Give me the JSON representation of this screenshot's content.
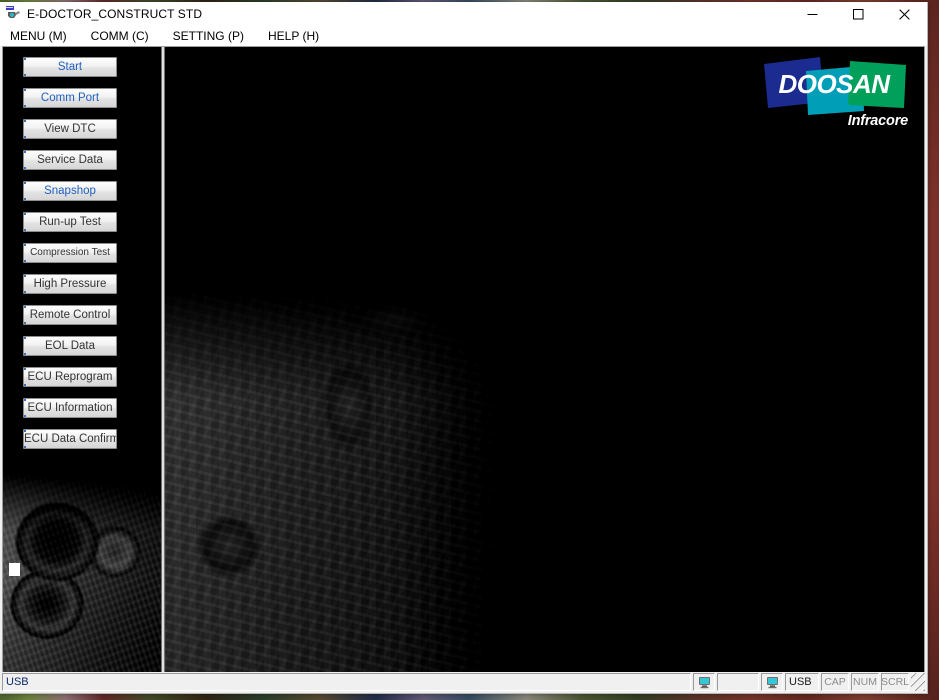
{
  "window": {
    "title": "E-DOCTOR_CONSTRUCT STD",
    "app_icon": "diagnostic-device-icon",
    "controls": {
      "minimize": "—",
      "maximize": "□",
      "close": "✕"
    }
  },
  "menu": {
    "items": [
      {
        "label": "MENU (M)",
        "name": "menu-menu"
      },
      {
        "label": "COMM (C)",
        "name": "menu-comm"
      },
      {
        "label": "SETTING (P)",
        "name": "menu-setting"
      },
      {
        "label": "HELP (H)",
        "name": "menu-help"
      }
    ]
  },
  "sidebar": {
    "buttons": [
      {
        "label": "Start",
        "accent": true
      },
      {
        "label": "Comm Port",
        "accent": true
      },
      {
        "label": "View DTC",
        "accent": false
      },
      {
        "label": "Service Data",
        "accent": false
      },
      {
        "label": "Snapshop",
        "accent": true
      },
      {
        "label": "Run-up Test",
        "accent": false
      },
      {
        "label": "Compression Test",
        "accent": false
      },
      {
        "label": "High Pressure",
        "accent": false
      },
      {
        "label": "Remote Control",
        "accent": false
      },
      {
        "label": "EOL Data",
        "accent": false
      },
      {
        "label": "ECU Reprogram",
        "accent": false
      },
      {
        "label": "ECU Information",
        "accent": false
      },
      {
        "label": "ECU Data Confirm",
        "accent": false
      }
    ]
  },
  "branding": {
    "wordmark": "DOOSAN",
    "subtitle": "Infracore",
    "colors": {
      "blue": "#1b2b8f",
      "teal": "#009fb7",
      "green": "#00a05b",
      "text": "#ffffff"
    }
  },
  "status_bar": {
    "message": "USB",
    "connection_label": "USB",
    "indicator_left": "monitor-icon",
    "indicator_right": "monitor-icon",
    "keys": [
      {
        "label": "CAP"
      },
      {
        "label": "NUM"
      },
      {
        "label": "SCRL"
      }
    ]
  }
}
